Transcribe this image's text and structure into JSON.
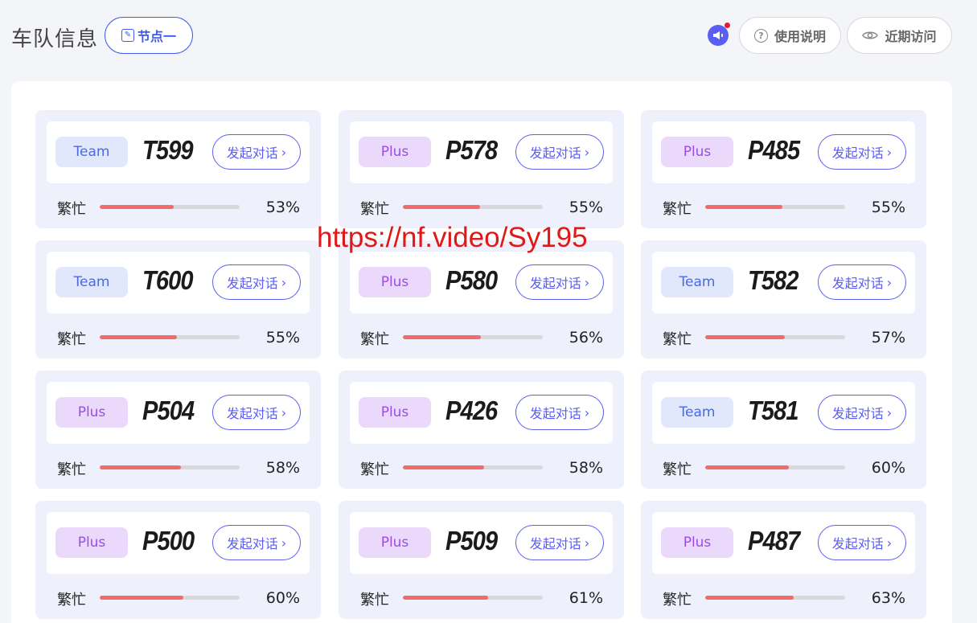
{
  "header": {
    "title": "车队信息",
    "node_label": "节点一",
    "help_label": "使用说明",
    "recent_label": "近期访问"
  },
  "colors": {
    "accent": "#5b5ef2",
    "progress": "#f26b6b",
    "team_badge_bg": "#e2e8fc",
    "plus_badge_bg": "#ead9fb"
  },
  "cards": [
    {
      "tier": "Team",
      "code": "T599",
      "chat_label": "发起对话",
      "status": "繁忙",
      "load": 53,
      "load_text": "53%"
    },
    {
      "tier": "Plus",
      "code": "P578",
      "chat_label": "发起对话",
      "status": "繁忙",
      "load": 55,
      "load_text": "55%"
    },
    {
      "tier": "Plus",
      "code": "P485",
      "chat_label": "发起对话",
      "status": "繁忙",
      "load": 55,
      "load_text": "55%"
    },
    {
      "tier": "Team",
      "code": "T600",
      "chat_label": "发起对话",
      "status": "繁忙",
      "load": 55,
      "load_text": "55%"
    },
    {
      "tier": "Plus",
      "code": "P580",
      "chat_label": "发起对话",
      "status": "繁忙",
      "load": 56,
      "load_text": "56%"
    },
    {
      "tier": "Team",
      "code": "T582",
      "chat_label": "发起对话",
      "status": "繁忙",
      "load": 57,
      "load_text": "57%"
    },
    {
      "tier": "Plus",
      "code": "P504",
      "chat_label": "发起对话",
      "status": "繁忙",
      "load": 58,
      "load_text": "58%"
    },
    {
      "tier": "Plus",
      "code": "P426",
      "chat_label": "发起对话",
      "status": "繁忙",
      "load": 58,
      "load_text": "58%"
    },
    {
      "tier": "Team",
      "code": "T581",
      "chat_label": "发起对话",
      "status": "繁忙",
      "load": 60,
      "load_text": "60%"
    },
    {
      "tier": "Plus",
      "code": "P500",
      "chat_label": "发起对话",
      "status": "繁忙",
      "load": 60,
      "load_text": "60%"
    },
    {
      "tier": "Plus",
      "code": "P509",
      "chat_label": "发起对话",
      "status": "繁忙",
      "load": 61,
      "load_text": "61%"
    },
    {
      "tier": "Plus",
      "code": "P487",
      "chat_label": "发起对话",
      "status": "繁忙",
      "load": 63,
      "load_text": "63%"
    }
  ],
  "watermark": "https://nf.video/Sy195"
}
